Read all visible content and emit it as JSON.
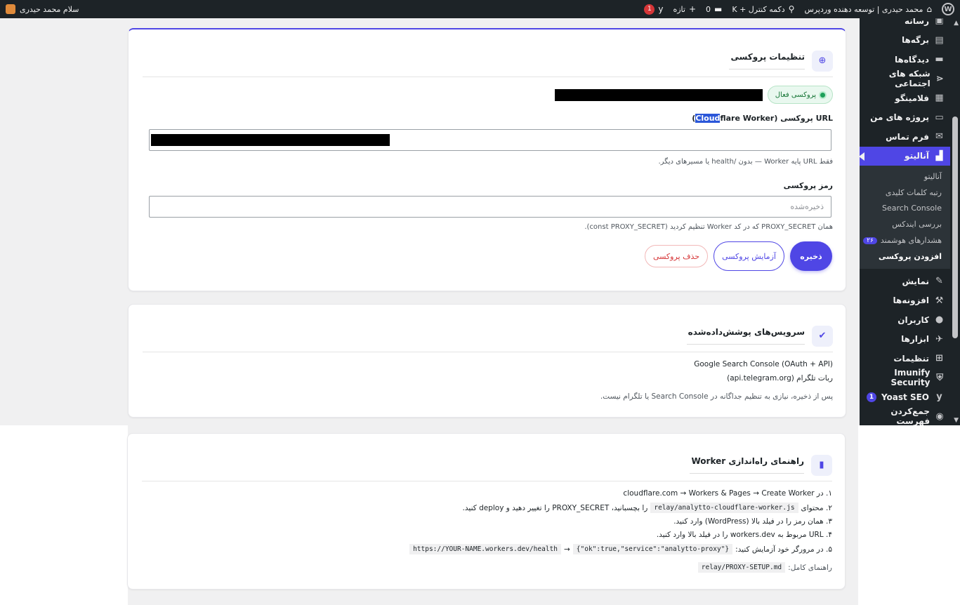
{
  "adminbar": {
    "site_name": "محمد حیدری | توسعه دهنده وردپرس",
    "search_label": "دکمه کنترل + K",
    "comments_count": "0",
    "new_label": "تازه",
    "notif_count": "1",
    "greeting": "سلام محمد حیدری"
  },
  "sidebar": {
    "items_top": [
      {
        "label": "رسانه",
        "icon": "media-icon"
      },
      {
        "label": "برگه‌ها",
        "icon": "pages-icon"
      },
      {
        "label": "دیدگاه‌ها",
        "icon": "comments-icon"
      },
      {
        "label": "شبکه های اجتماعی",
        "icon": "share-icon"
      },
      {
        "label": "فلامینگو",
        "icon": "flamingo-icon"
      },
      {
        "label": "پروژه های من",
        "icon": "folder-icon"
      },
      {
        "label": "فرم تماس",
        "icon": "mail-icon"
      }
    ],
    "current": {
      "label": "آنالیتو",
      "icon": "chart-icon"
    },
    "submenu": [
      {
        "label": "آنالیتو"
      },
      {
        "label": "رتبه کلمات کلیدی"
      },
      {
        "label": "Search Console"
      },
      {
        "label": "بررسی ایندکس"
      },
      {
        "label": "هشدارهای هوشمند",
        "count": "۲۶"
      },
      {
        "label": "افزودن پروکسی"
      }
    ],
    "items_bottom": [
      {
        "label": "نمایش",
        "icon": "brush-icon"
      },
      {
        "label": "افزونه‌ها",
        "icon": "plugin-icon"
      },
      {
        "label": "کاربران",
        "icon": "user-icon"
      },
      {
        "label": "ابزارها",
        "icon": "wrench-icon"
      },
      {
        "label": "تنظیمات",
        "icon": "settings-icon"
      },
      {
        "label": "Imunify Security",
        "icon": "shield-icon"
      },
      {
        "label": "Yoast SEO",
        "icon": "yoast-icon",
        "count": "1"
      },
      {
        "label": "جمع‌کردن فهرست",
        "icon": "collapse-icon"
      }
    ]
  },
  "proxy_card": {
    "title": "تنظیمات پروکسی",
    "status": "پروکسی فعال",
    "url_label_before": "URL پروکسی (",
    "url_label_highlight": "Cloud",
    "url_label_after": "flare Worker)",
    "url_help": "فقط URL پایه Worker — بدون /health یا مسیرهای دیگر.",
    "secret_label": "رمز پروکسی",
    "secret_placeholder": "ذخیره‌شده",
    "secret_help": "همان PROXY_SECRET که در کد Worker تنظیم کردید (const PROXY_SECRET).",
    "save_btn": "ذخیره",
    "test_btn": "آزمایش پروکسی",
    "delete_btn": "حذف پروکسی"
  },
  "services_card": {
    "title": "سرویس‌های پوشش‌داده‌شده",
    "services": [
      "Google Search Console (OAuth + API)",
      "ربات تلگرام (api.telegram.org)"
    ],
    "note": "پس از ذخیره، نیازی به تنظیم جداگانه در Search Console یا تلگرام نیست."
  },
  "guide_card": {
    "title": "راهنمای راه‌اندازی Worker",
    "step1": "۱. در cloudflare.com → Workers & Pages → Create Worker",
    "step2_a": "۲. محتوای",
    "step2_code": "relay/analytto-cloudflare-worker.js",
    "step2_b": "را بچسبانید، PROXY_SECRET را تغییر دهید و deploy کنید.",
    "step3": "۳. همان رمز را در فیلد بالا (WordPress) وارد کنید.",
    "step4": "۴. URL مربوط به workers.dev را در فیلد بالا وارد کنید.",
    "step5_a": "۵. در مرورگر خود آزمایش کنید:",
    "step5_code1": "{\"ok\":true,\"service\":\"analytto-proxy\"}",
    "step5_arrow": "→",
    "step5_code2": "https://YOUR-NAME.workers.dev/health",
    "full_label": "راهنمای کامل:",
    "full_code": "relay/PROXY-SETUP.md"
  }
}
